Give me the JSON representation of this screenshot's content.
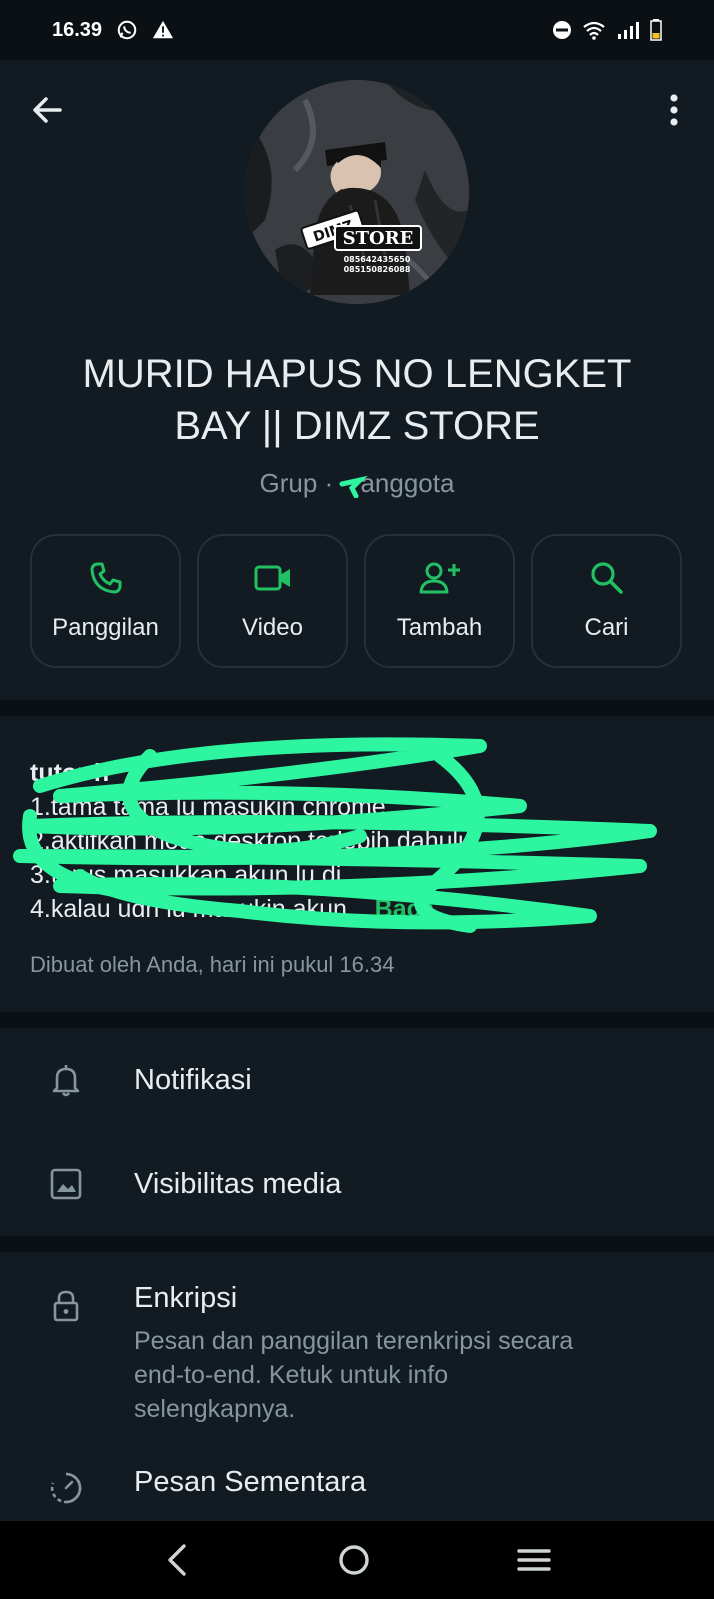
{
  "status_bar": {
    "time": "16.39"
  },
  "header": {
    "group_name": "MURID HAPUS NO LENGKET BAY || DIMZ STORE",
    "subtitle_prefix": "Grup · ",
    "subtitle_suffix": "anggota",
    "avatar": {
      "badge_top": "DIMZ",
      "badge_bottom": "STORE",
      "phone_1": "085642435650",
      "phone_2": "085150826088"
    }
  },
  "actions": [
    {
      "label": "Panggilan",
      "icon": "phone-icon"
    },
    {
      "label": "Video",
      "icon": "video-icon"
    },
    {
      "label": "Tambah",
      "icon": "add-person-icon"
    },
    {
      "label": "Cari",
      "icon": "search-icon"
    }
  ],
  "description": {
    "line_1": "tutor h",
    "line_2": "1.tama tama lu masukin chrome",
    "line_3": "2.aktifkan mode desktop terlebih dahulu",
    "line_4": "3.terus masukkan akun lu di",
    "line_5": "4.kalau udh lu masukin akun...",
    "more": "Baca",
    "meta": "Dibuat oleh Anda, hari ini pukul 16.34"
  },
  "settings": {
    "notifications": "Notifikasi",
    "media_visibility": "Visibilitas media",
    "encryption": "Enkripsi",
    "encryption_desc": "Pesan dan panggilan terenkripsi secara end-to-end. Ketuk untuk info selengkapnya.",
    "disappearing": "Pesan Sementara"
  },
  "colors": {
    "accent": "#21c063",
    "background": "#0b1014",
    "surface": "#111b21",
    "scribble": "#2ef5a0"
  }
}
